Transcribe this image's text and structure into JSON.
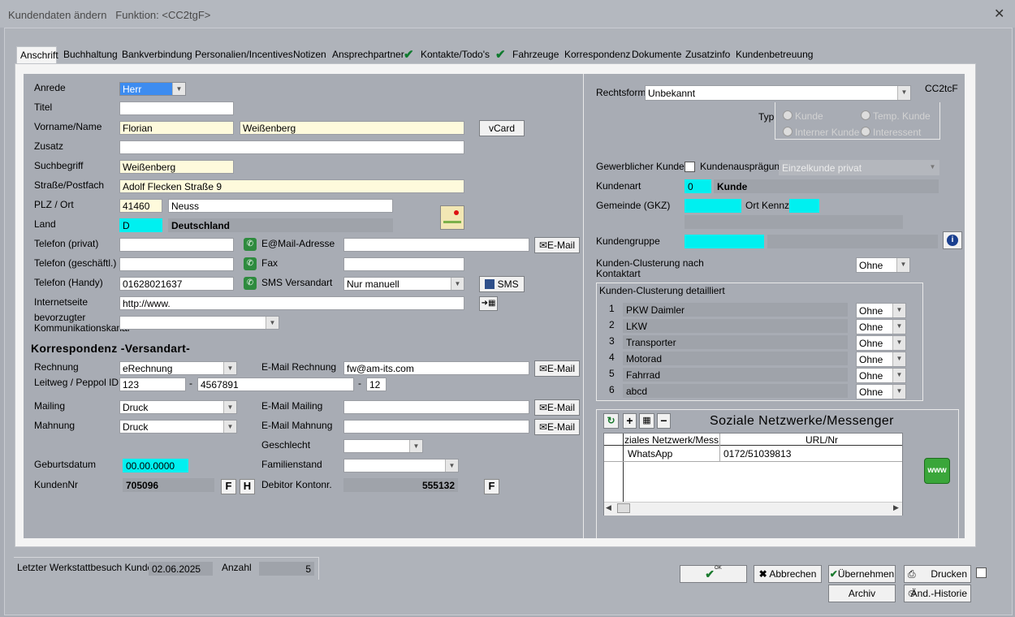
{
  "window": {
    "title": "Kundendaten ändern",
    "function_label": "Funktion: <CC2tgF>"
  },
  "tabs": [
    "Anschrift",
    "Buchhaltung",
    "Bankverbindung",
    "Personalien/Incentives",
    "Notizen",
    "Ansprechpartner",
    "Kontakte/Todo's",
    "Fahrzeuge",
    "Korrespondenz",
    "Dokumente",
    "Zusatzinfo",
    "Kundenbetreuung"
  ],
  "left": {
    "anrede": {
      "label": "Anrede",
      "value": "Herr"
    },
    "titel": {
      "label": "Titel",
      "value": ""
    },
    "vorname": {
      "label": "Vorname/Name",
      "first": "Florian",
      "last": "Weißenberg",
      "vcard": "vCard"
    },
    "zusatz": {
      "label": "Zusatz",
      "value": ""
    },
    "suchbegriff": {
      "label": "Suchbegriff",
      "value": "Weißenberg"
    },
    "strasse": {
      "label": "Straße/Postfach",
      "value": "Adolf Flecken Straße 9"
    },
    "plz": {
      "label": "PLZ / Ort",
      "plz": "41460",
      "ort": "Neuss"
    },
    "land": {
      "label": "Land",
      "code": "D",
      "name": "Deutschland"
    },
    "tel_privat": {
      "label": "Telefon (privat)",
      "value": ""
    },
    "tel_gesch": {
      "label": "Telefon (geschäftl.)",
      "value": ""
    },
    "tel_handy": {
      "label": "Telefon (Handy)",
      "value": "01628021637"
    },
    "email": {
      "label": "E@Mail-Adresse",
      "value": "",
      "button": "E-Mail"
    },
    "fax": {
      "label": "Fax",
      "value": ""
    },
    "sms": {
      "label": "SMS Versandart",
      "value": "Nur manuell",
      "button": "SMS"
    },
    "internet": {
      "label": "Internetseite",
      "value": "http://www."
    },
    "kommkanal": {
      "label1": "bevorzugter",
      "label2": "Kommunikationskanal",
      "value": ""
    }
  },
  "korr": {
    "title": "Korrespondenz -Versandart-",
    "rechnung": {
      "label": "Rechnung",
      "value": "eRechnung"
    },
    "email_rechnung": {
      "label": "E-Mail Rechnung",
      "value": "fw@am-its.com",
      "button": "E-Mail"
    },
    "leitweg": {
      "label": "Leitweg / Peppol ID",
      "a": "123",
      "b": "4567891",
      "c": "12",
      "sep": "-"
    },
    "mailing": {
      "label": "Mailing",
      "value": "Druck"
    },
    "email_mailing": {
      "label": "E-Mail Mailing",
      "value": "",
      "button": "E-Mail"
    },
    "mahnung": {
      "label": "Mahnung",
      "value": "Druck"
    },
    "email_mahnung": {
      "label": "E-Mail Mahnung",
      "value": "",
      "button": "E-Mail"
    },
    "geschlecht": {
      "label": "Geschlecht",
      "value": ""
    },
    "geburtsdatum": {
      "label": "Geburtsdatum",
      "value": "00.00.0000"
    },
    "familienstand": {
      "label": "Familienstand",
      "value": ""
    },
    "kundennr": {
      "label": "KundenNr",
      "value": "705096",
      "btn_f": "F",
      "btn_h": "H"
    },
    "debitor": {
      "label": "Debitor Kontonr.",
      "value": "555132",
      "btn_f": "F"
    }
  },
  "right": {
    "rechtsform": {
      "label": "Rechtsform",
      "value": "Unbekannt",
      "code": "CC2tcF"
    },
    "typ": {
      "label": "Typ",
      "options": [
        "Kunde",
        "Temp. Kunde",
        "Interner Kunde",
        "Interessent"
      ]
    },
    "gewerblich": {
      "label": "Gewerblicher Kunde",
      "auspraegung_label": "Kundenausprägung",
      "auspraegung": "Einzelkunde privat"
    },
    "kundenart": {
      "label": "Kundenart",
      "code": "0",
      "name": "Kunde"
    },
    "gemeinde": {
      "label": "Gemeinde (GKZ)",
      "ortkennz": "Ort Kennz."
    },
    "kundengruppe": {
      "label": "Kundengruppe"
    },
    "clustering": {
      "label1": "Kunden-Clusterung nach",
      "label2": "Kontaktart",
      "value": "Ohne"
    },
    "detail": {
      "title": "Kunden-Clusterung detailliert",
      "rows": [
        {
          "n": "1",
          "name": "PKW Daimler",
          "value": "Ohne"
        },
        {
          "n": "2",
          "name": "LKW",
          "value": "Ohne"
        },
        {
          "n": "3",
          "name": "Transporter",
          "value": "Ohne"
        },
        {
          "n": "4",
          "name": "Motorad",
          "value": "Ohne"
        },
        {
          "n": "5",
          "name": "Fahrrad",
          "value": "Ohne"
        },
        {
          "n": "6",
          "name": "abcd",
          "value": "Ohne"
        }
      ]
    },
    "social": {
      "title": "Soziale Netzwerke/Messenger",
      "col1": "ziales Netzwerk/Messen",
      "col2": "URL/Nr",
      "rows": [
        {
          "net": "WhatsApp",
          "url": "0172/51039813"
        }
      ],
      "www": "www"
    }
  },
  "footer": {
    "werkstatt_label": "Letzter Werkstattbesuch Kunde",
    "werkstatt_date": "02.06.2025",
    "anzahl_label": "Anzahl",
    "anzahl": "5",
    "ok": "OK",
    "abbrechen": "Abbrechen",
    "uebernehmen": "Übernehmen",
    "drucken": "Drucken",
    "archiv": "Archiv",
    "historie": "Änd.-Historie"
  },
  "colors": {
    "background": "#a8acb4",
    "panel": "#f4f4f4",
    "cyan": "#00f0f0",
    "yellow_field": "#fefadc",
    "check_green": "#0f7a2e"
  }
}
